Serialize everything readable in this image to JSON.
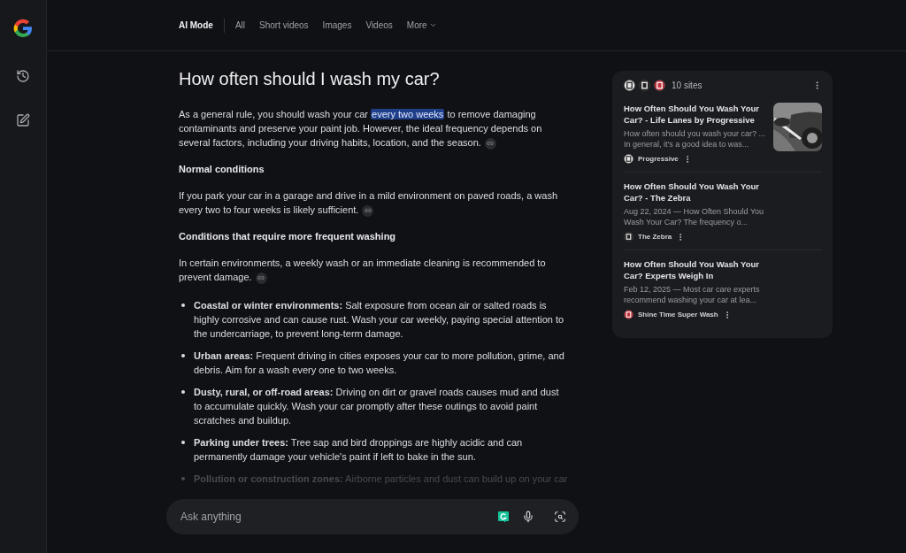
{
  "nav": {
    "tabs": [
      {
        "label": "AI Mode",
        "selected": true,
        "kind": "tab"
      },
      {
        "label": "All",
        "selected": false,
        "kind": "tab"
      },
      {
        "label": "Short videos",
        "selected": false,
        "kind": "tab"
      },
      {
        "label": "Images",
        "selected": false,
        "kind": "tab"
      },
      {
        "label": "Videos",
        "selected": false,
        "kind": "tab"
      },
      {
        "label": "More",
        "selected": false,
        "kind": "menu"
      }
    ]
  },
  "question": "How often should I wash my car?",
  "answer": [
    {
      "kind": "paragraph",
      "cited": true,
      "segments": [
        {
          "text": "As a general rule, you should wash your car ",
          "highlighted": false
        },
        {
          "text": "every two weeks",
          "highlighted": true
        },
        {
          "text": " to remove damaging contaminants and preserve your paint job. However, the ideal frequency depends on several factors, including your driving habits, location, and the season.",
          "highlighted": false
        }
      ]
    },
    {
      "kind": "heading",
      "text": "Normal conditions"
    },
    {
      "kind": "paragraph",
      "cited": true,
      "segments": [
        {
          "text": "If you park your car in a garage and drive in a mild environment on paved roads, a wash every two to four weeks is likely sufficient.",
          "highlighted": false
        }
      ]
    },
    {
      "kind": "heading",
      "text": "Conditions that require more frequent washing"
    },
    {
      "kind": "paragraph",
      "cited": true,
      "segments": [
        {
          "text": "In certain environments, a weekly wash or an immediate cleaning is recommended to prevent damage.",
          "highlighted": false
        }
      ]
    },
    {
      "kind": "bullets",
      "items": [
        {
          "text": "**Coastal or winter environments:** Salt exposure from ocean air or salted roads is highly corrosive and can cause rust. Wash your car weekly, paying special attention to the undercarriage, to prevent long-term damage.",
          "faded": false
        },
        {
          "text": "**Urban areas:** Frequent driving in cities exposes your car to more pollution, grime, and debris. Aim for a wash every one to two weeks.",
          "faded": false
        },
        {
          "text": "**Dusty, rural, or off-road areas:** Driving on dirt or gravel roads causes mud and dust to accumulate quickly. Wash your car promptly after these outings to avoid paint scratches and buildup.",
          "faded": false
        },
        {
          "text": "**Parking under trees:** Tree sap and bird droppings are highly acidic and can permanently damage your vehicle's paint if left to bake in the sun.",
          "faded": false
        },
        {
          "text": "**Pollution or construction zones:** Airborne particles and dust can build up on your car",
          "faded": true
        }
      ]
    }
  ],
  "search": {
    "placeholder": "Ask anything"
  },
  "sources": {
    "count_label": "10 sites",
    "items": [
      {
        "title": "How Often Should You Wash Your Car? - Life Lanes by Progressive",
        "snippet": "How often should you wash your car? ... In general, it's a good idea to was...",
        "site": "Progressive",
        "color": "#e8e8e8"
      },
      {
        "title": "How Often Should You Wash Your Car? - The Zebra",
        "snippet": "Aug 22, 2024 — How Often Should You Wash Your Car? The frequency o...",
        "site": "The Zebra",
        "color": "#222222"
      },
      {
        "title": "How Often Should You Wash Your Car? Experts Weigh In",
        "snippet": "Feb 12, 2025 — Most car care experts recommend washing your car at lea...",
        "site": "Shine Time Super Wash",
        "color": "#c0303a"
      }
    ]
  }
}
